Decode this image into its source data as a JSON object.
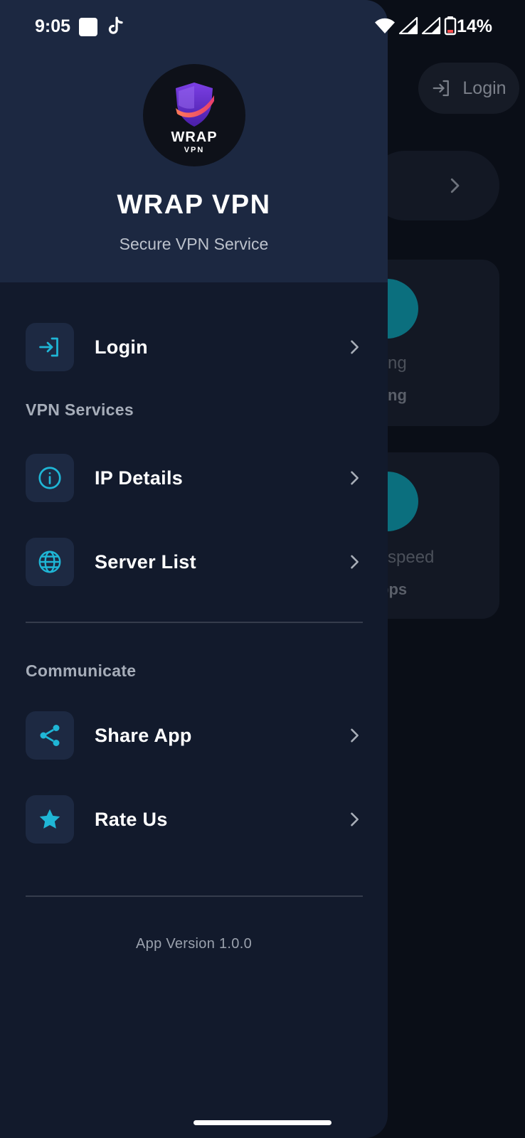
{
  "status_bar": {
    "time": "9:05",
    "battery": "14%",
    "icons": [
      "notification-square-icon",
      "tiktok-icon",
      "wifi-icon",
      "signal-icon",
      "signal-icon",
      "battery-icon"
    ]
  },
  "background": {
    "login_label": "Login",
    "card1_label": "ng",
    "card1_value": "ng",
    "card2_label": "l speed",
    "card2_value": "bps"
  },
  "drawer": {
    "logo": {
      "word": "WRAP",
      "sub": "VPN"
    },
    "title": "WRAP VPN",
    "subtitle": "Secure VPN Service",
    "login": {
      "label": "Login",
      "icon": "login-icon"
    },
    "section_vpn": "VPN Services",
    "vpn_items": [
      {
        "label": "IP Details",
        "icon": "info-icon"
      },
      {
        "label": "Server List",
        "icon": "globe-icon"
      }
    ],
    "section_comm": "Communicate",
    "comm_items": [
      {
        "label": "Share App",
        "icon": "share-icon"
      },
      {
        "label": "Rate Us",
        "icon": "star-icon"
      }
    ],
    "version": "App Version 1.0.0"
  },
  "colors": {
    "accent": "#1fb6d6",
    "drawer_bg": "#121a2c",
    "header_bg": "#1c2841",
    "icon_box": "#1d2942"
  }
}
